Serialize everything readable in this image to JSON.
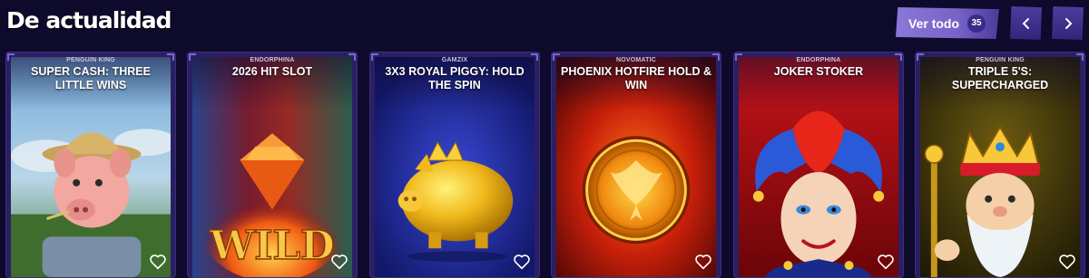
{
  "section": {
    "title": "De actualidad",
    "see_all_label": "Ver todo",
    "count": "35"
  },
  "nav": {
    "prev_icon": "chevron-left-icon",
    "next_icon": "chevron-right-icon"
  },
  "colors": {
    "background": "#0d0a2b",
    "accent": "#7763c7",
    "card_frame": "#2b1f63"
  },
  "games": [
    {
      "provider": "PENGUIN KING",
      "title": "SUPER CASH: THREE LITTLE WINS",
      "art": "pig-farmer"
    },
    {
      "provider": "ENDORPHINA",
      "title": "2026 HIT SLOT",
      "art": "wild-diamond"
    },
    {
      "provider": "GAMZIX",
      "title": "3X3 ROYAL PIGGY: HOLD THE SPIN",
      "art": "golden-piggy"
    },
    {
      "provider": "NOVOMATIC",
      "title": "PHOENIX HOTFIRE HOLD & WIN",
      "art": "phoenix-coin"
    },
    {
      "provider": "ENDORPHINA",
      "title": "JOKER STOKER",
      "art": "joker"
    },
    {
      "provider": "PENGUIN KING",
      "title": "TRIPLE 5'S: SUPERCHARGED",
      "art": "king"
    }
  ]
}
